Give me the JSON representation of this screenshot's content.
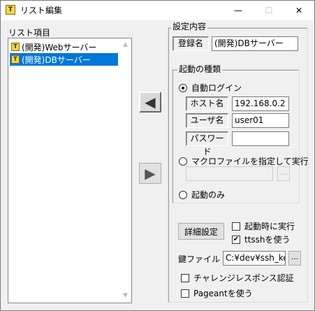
{
  "window": {
    "title": "リスト編集",
    "app_icon_letter": "T",
    "minimize": "—",
    "maximize": "☐",
    "close": "✕"
  },
  "list": {
    "header": "リスト項目",
    "items": [
      {
        "label": "(開発)Webサーバー",
        "selected": false
      },
      {
        "label": "(開発)DBサーバー",
        "selected": true
      }
    ]
  },
  "buttons": {
    "move_left": "◀",
    "move_right": "▶",
    "detail": "詳細設定",
    "browse": "...",
    "key_browse": "..."
  },
  "settings": {
    "group_title": "設定内容",
    "registered_name_label": "登録名",
    "registered_name_value": "(開発)DBサーバー",
    "launch_group_title": "起動の種類",
    "auto_login_label": "自動ログイン",
    "host_label": "ホスト名",
    "host_value": "192.168.0.2",
    "user_label": "ユーザ名",
    "user_value": "user01",
    "password_label": "パスワード",
    "password_value": "",
    "macro_label": "マクロファイルを指定して実行",
    "macro_value": "",
    "launch_only_label": "起動のみ",
    "run_at_startup_label": "起動時に実行",
    "use_ttssh_label": "ttsshを使う",
    "key_file_label": "鍵ファイル",
    "key_file_value": "C:¥dev¥ssh_key",
    "challenge_response_label": "チャレンジレスポンス認証",
    "pageant_label": "Pageantを使う",
    "check_mark": "✔"
  },
  "state": {
    "launch_type": "auto_login",
    "run_at_startup": false,
    "use_ttssh": true,
    "challenge_response": false,
    "use_pageant": false
  }
}
